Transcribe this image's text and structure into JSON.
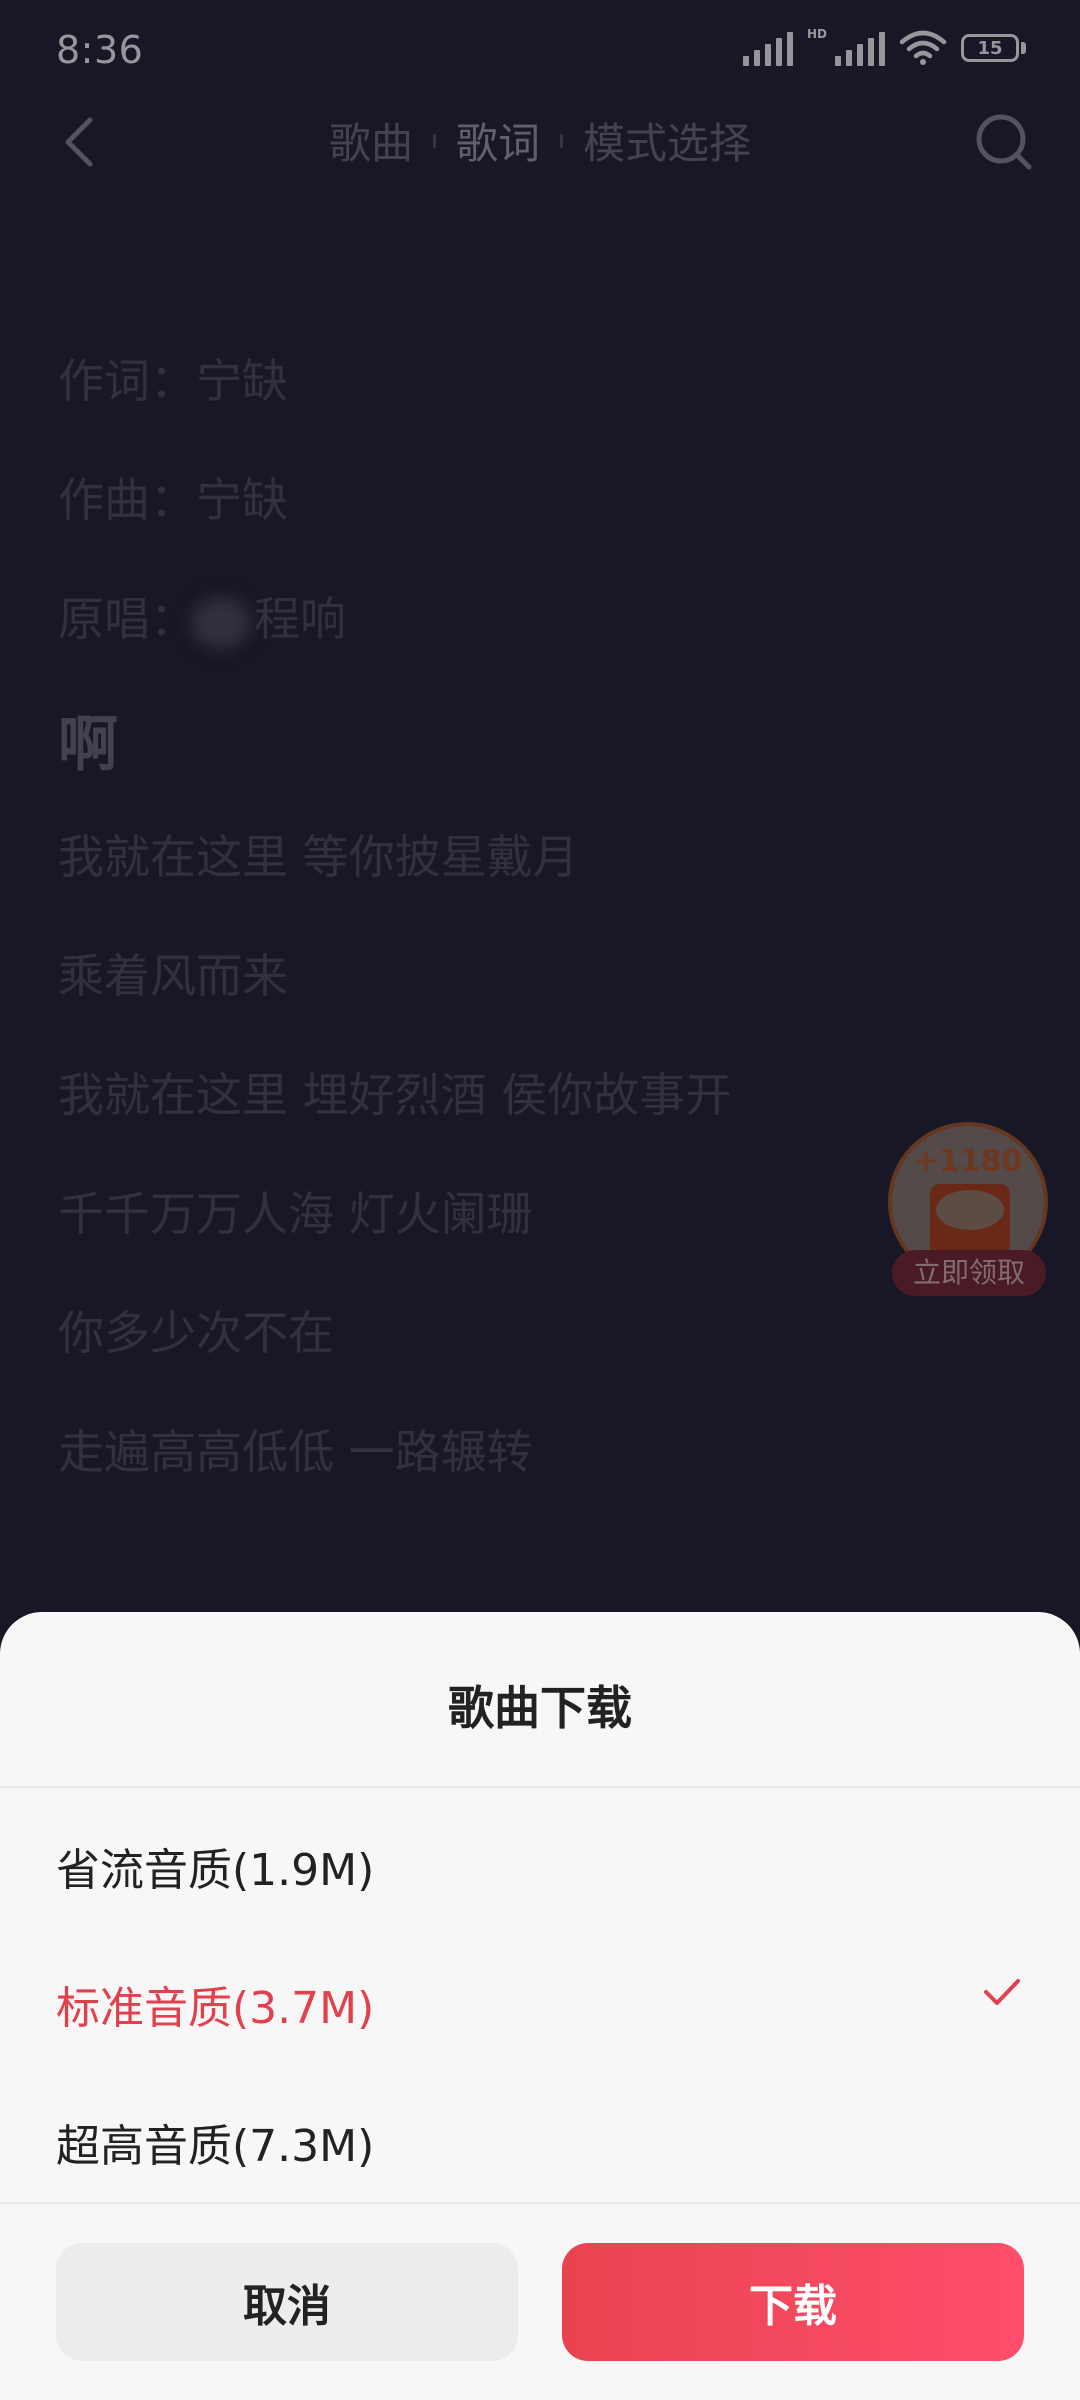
{
  "status_bar": {
    "time": "8:36",
    "hd_label": "HD",
    "battery_level": "15"
  },
  "header": {
    "tabs": [
      "歌曲",
      "歌词",
      "模式选择"
    ],
    "active_tab_index": 1
  },
  "lyrics": {
    "lines": [
      "作词：宁缺",
      "作曲：宁缺",
      "原唱：",
      "啊",
      "我就在这里 等你披星戴月",
      "乘着风而来",
      "我就在这里 埋好烈酒 侯你故事开",
      "千千万万人海 灯火阑珊",
      "你多少次不在",
      "走遍高高低低 一路辗转"
    ],
    "singer_visible": "程响"
  },
  "reward": {
    "amount": "+1180",
    "claim_label": "立即领取"
  },
  "sheet": {
    "title": "歌曲下载",
    "options": [
      {
        "label": "省流音质(1.9M)",
        "selected": false
      },
      {
        "label": "标准音质(3.7M)",
        "selected": true
      },
      {
        "label": "超高音质(7.3M)",
        "selected": false
      }
    ],
    "cancel_label": "取消",
    "download_label": "下载"
  },
  "colors": {
    "accent": "#e0414c",
    "download_gradient_start": "#e9434f",
    "download_gradient_end": "#ff4e6c",
    "sheet_bg": "#f7f7f8"
  }
}
